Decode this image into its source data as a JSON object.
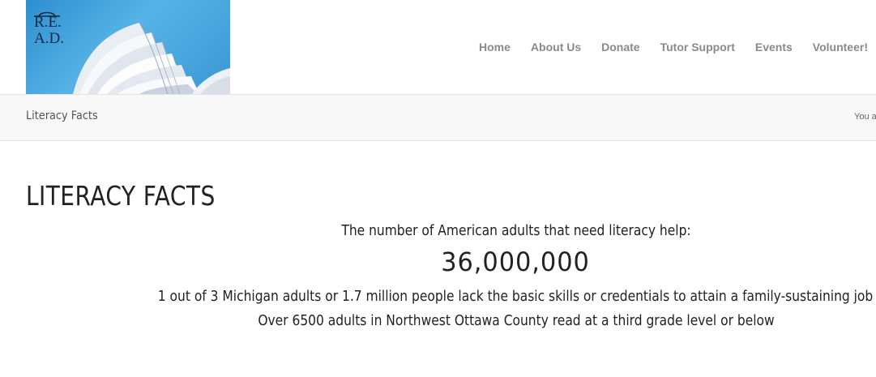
{
  "logo": {
    "line1": "R.E.",
    "line2": "A.D."
  },
  "nav": {
    "items": [
      {
        "label": "Home"
      },
      {
        "label": "About Us"
      },
      {
        "label": "Donate"
      },
      {
        "label": "Tutor Support"
      },
      {
        "label": "Events"
      },
      {
        "label": "Volunteer!"
      }
    ]
  },
  "title_bar": {
    "title": "Literacy Facts",
    "breadcrumb_prefix": "You a"
  },
  "main": {
    "heading": "LITERACY FACTS",
    "intro": "The number of American adults that need literacy help:",
    "big_number": "36,000,000",
    "fact_1": "1 out of 3 Michigan adults or 1.7 million people lack the basic skills or credentials to attain a family-sustaining job",
    "fact_2": "Over 6500 adults in Northwest Ottawa County read at a third grade level or below"
  }
}
